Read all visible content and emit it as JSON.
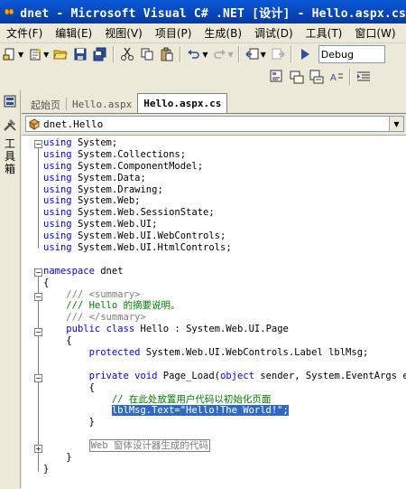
{
  "window": {
    "title": "dnet - Microsoft Visual C# .NET [设计] - Hello.aspx.cs"
  },
  "menu": [
    "文件(F)",
    "编辑(E)",
    "视图(V)",
    "项目(P)",
    "生成(B)",
    "调试(D)",
    "工具(T)",
    "窗口(W)"
  ],
  "toolbar": {
    "configuration": "Debug"
  },
  "left_toolbox": {
    "label_chars": [
      "工",
      "具",
      "箱"
    ]
  },
  "tabs": [
    {
      "label": "起始页",
      "active": false
    },
    {
      "label": "Hello.aspx",
      "active": false
    },
    {
      "label": "Hello.aspx.cs",
      "active": true
    }
  ],
  "class_dropdown": {
    "value": "dnet.Hello"
  },
  "code": {
    "usings": [
      "System",
      "System.Collections",
      "System.ComponentModel",
      "System.Data",
      "System.Drawing",
      "System.Web",
      "System.Web.SessionState",
      "System.Web.UI",
      "System.Web.UI.WebControls",
      "System.Web.UI.HtmlControls"
    ],
    "namespace_kw": "namespace",
    "namespace_name": "dnet",
    "summary_open": "/// <summary>",
    "summary_text": "/// Hello 的摘要说明。",
    "summary_close": "/// </summary>",
    "class_decl_kw1": "public",
    "class_decl_kw2": "class",
    "class_decl_rest": " Hello : System.Web.UI.Page",
    "field_kw": "protected",
    "field_rest": " System.Web.UI.WebControls.Label lblMsg;",
    "method_kw1": "private",
    "method_kw2": "void",
    "method_rest1": " Page_Load(",
    "method_kw3": "object",
    "method_rest2": " sender, System.EventArgs e)",
    "comment_line": "// 在此处放置用户代码以初始化页面",
    "selected_line": "lblMsg.Text=\"Hello!The World!\";",
    "region_label": "Web 窗体设计器生成的代码"
  }
}
